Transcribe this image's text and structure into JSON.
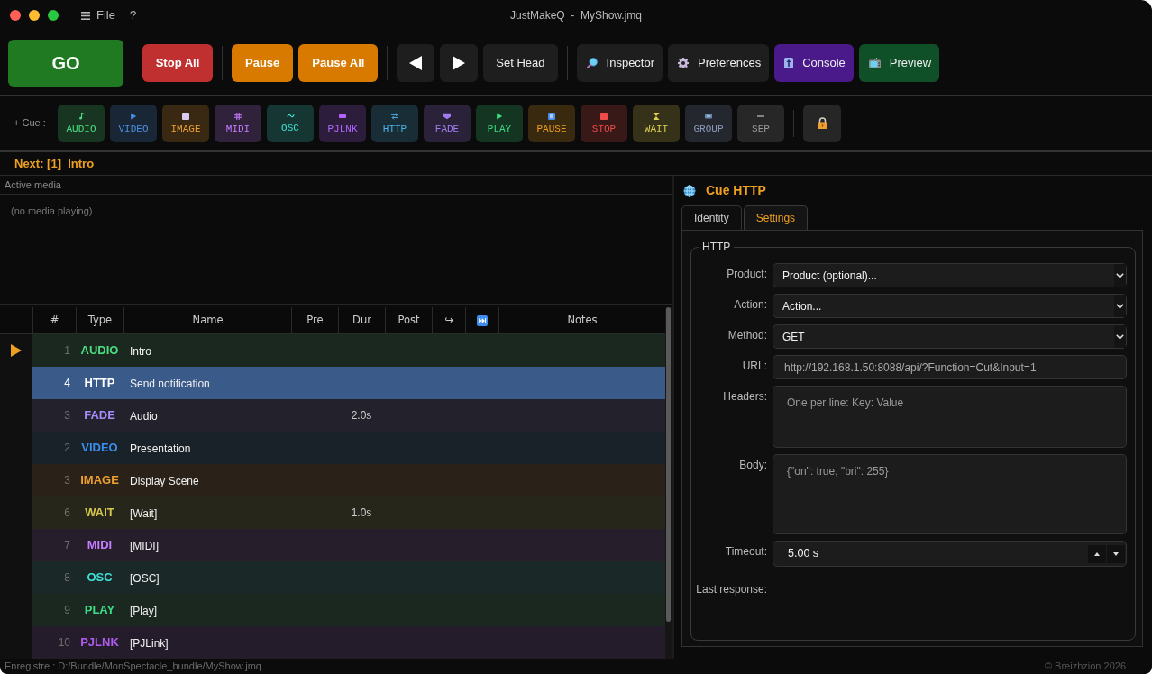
{
  "window": {
    "title": "JustMakeQ  -  MyShow.jmq"
  },
  "menu": [
    {
      "label": "File",
      "menu_icon": true
    },
    {
      "label": "?",
      "menu_icon": false
    }
  ],
  "toolbar": [
    [
      {
        "kind": "go",
        "label": "GO"
      }
    ],
    [
      {
        "kind": "stop",
        "label": "Stop All"
      }
    ],
    [
      {
        "kind": "pause",
        "label": "Pause"
      },
      {
        "kind": "pause",
        "label": "Pause All"
      }
    ],
    [
      {
        "kind": "back"
      },
      {
        "kind": "forward"
      },
      {
        "kind": "plain",
        "label": "Set Head"
      }
    ],
    [
      {
        "kind": "inspector",
        "label": "Inspector"
      },
      {
        "kind": "preferences",
        "label": "Preferences"
      },
      {
        "kind": "console",
        "label": "Console"
      },
      {
        "kind": "preview",
        "label": "Preview"
      }
    ]
  ],
  "cue_bar": {
    "label": "+ Cue :",
    "cues": [
      {
        "kind": "audio",
        "label": "AUDIO"
      },
      {
        "kind": "video",
        "label": "VIDEO"
      },
      {
        "kind": "image",
        "label": "IMAGE"
      },
      {
        "kind": "midi",
        "label": "MIDI"
      },
      {
        "kind": "osc",
        "label": "OSC"
      },
      {
        "kind": "pjlink",
        "label": "PJLNK"
      },
      {
        "kind": "http",
        "label": "HTTP"
      },
      {
        "kind": "fade",
        "label": "FADE"
      },
      {
        "kind": "play",
        "label": "PLAY"
      },
      {
        "kind": "pause",
        "label": "PAUSE"
      },
      {
        "kind": "stop",
        "label": "STOP"
      },
      {
        "kind": "wait",
        "label": "WAIT"
      },
      {
        "kind": "group",
        "label": "GROUP"
      },
      {
        "kind": "separator",
        "label": "SEP"
      }
    ]
  },
  "next_cue": "Next: [1]  Intro",
  "active_media": {
    "title": "Active media",
    "empty_text": "(no media playing)"
  },
  "cue_table": {
    "columns": [
      {
        "kind": "text",
        "label": "#"
      },
      {
        "kind": "text",
        "label": "Type"
      },
      {
        "kind": "text",
        "label": "Name"
      },
      {
        "kind": "text",
        "label": "Pre"
      },
      {
        "kind": "text",
        "label": "Dur"
      },
      {
        "kind": "text",
        "label": "Post"
      },
      {
        "kind": "text",
        "label": "↪"
      },
      {
        "kind": "icon"
      },
      {
        "kind": "text",
        "label": "Notes"
      }
    ],
    "rows": [
      {
        "number": "1",
        "type": "AUDIO",
        "name": "Intro",
        "color": "#4ade80",
        "selected": false,
        "current": true
      },
      {
        "number": "4",
        "type": "HTTP",
        "name": "Send notification",
        "selected": true,
        "current": false
      },
      {
        "number": "3",
        "type": "FADE",
        "name": "Audio",
        "dur": "2.0s",
        "color": "#a78bfa",
        "selected": false,
        "current": false
      },
      {
        "number": "2",
        "type": "VIDEO",
        "name": "Presentation",
        "color": "#3b8eea",
        "selected": false,
        "current": false
      },
      {
        "number": "3",
        "type": "IMAGE",
        "name": "Display Scene",
        "color": "#f0a030",
        "selected": false,
        "current": false
      },
      {
        "number": "6",
        "type": "WAIT",
        "name": "[Wait]",
        "dur": "1.0s",
        "color": "#d6c94a",
        "selected": false,
        "current": false
      },
      {
        "number": "7",
        "type": "MIDI",
        "name": "[MIDI]",
        "color": "#c77dff",
        "selected": false,
        "current": false
      },
      {
        "number": "8",
        "type": "OSC",
        "name": "[OSC]",
        "color": "#3ee0d6",
        "selected": false,
        "current": false
      },
      {
        "number": "9",
        "type": "PLAY",
        "name": "[Play]",
        "color": "#3ddc84",
        "selected": false,
        "current": false
      },
      {
        "number": "10",
        "type": "PJLNK",
        "name": "[PJLink]",
        "color": "#b05cf0",
        "selected": false,
        "current": false
      }
    ]
  },
  "inspector": {
    "kind": "http",
    "title": "Cue HTTP",
    "tabs": [
      {
        "label": "Identity",
        "selected": false
      },
      {
        "label": "Settings",
        "selected": true
      }
    ],
    "group": {
      "title": "HTTP",
      "fields": [
        {
          "kind": "combo",
          "label": "Product:",
          "value": "Product (optional)..."
        },
        {
          "kind": "combo",
          "label": "Action:",
          "value": "Action..."
        },
        {
          "kind": "combo",
          "label": "Method:",
          "value": "GET"
        },
        {
          "kind": "line",
          "label": "URL:",
          "placeholder": "http://192.168.1.50:8088/api/?Function=Cut&Input=1"
        },
        {
          "kind": "textarea",
          "label": "Headers:",
          "placeholder": "One per line: Key: Value"
        },
        {
          "kind": "textarea",
          "label": "Body:",
          "placeholder": "{\"on\": true, \"bri\": 255}"
        },
        {
          "kind": "spin",
          "label": "Timeout:",
          "value": "5.00 s"
        },
        {
          "kind": "label",
          "label": "Last response:"
        }
      ]
    }
  },
  "status_bar": {
    "path": "Enregistre : D:/Bundle/MonSpectacle_bundle/MyShow.jmq",
    "copyright": "© Breizhzion 2026"
  }
}
